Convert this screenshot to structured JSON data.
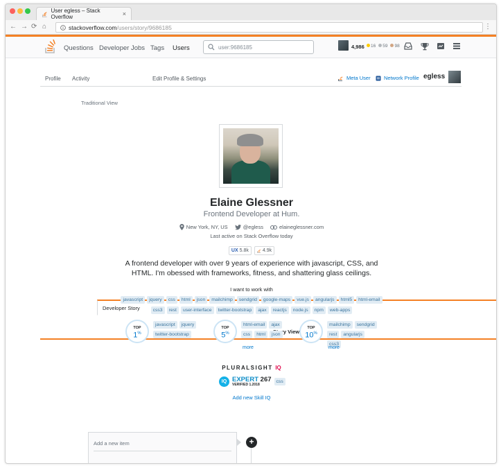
{
  "browser": {
    "tab_title": "User egless – Stack Overflow",
    "tab_close": "×",
    "url_host": "stackoverflow.com",
    "url_path": "/users/story/9686185"
  },
  "topbar": {
    "nav": [
      "Questions",
      "Developer Jobs",
      "Tags",
      "Users"
    ],
    "search_value": "user:9686185",
    "reputation": "4,986",
    "gold": "16",
    "silver": "59",
    "bronze": "98"
  },
  "profile_tabs": {
    "tabs": [
      "Profile",
      "Activity",
      "Developer Story",
      "Edit Profile & Settings"
    ],
    "meta_user": "Meta User",
    "network_profile": "Network Profile",
    "username": "egless"
  },
  "subtabs": [
    "Story View",
    "Traditional View"
  ],
  "person": {
    "name": "Elaine Glessner",
    "role": "Frontend Developer at Hum.",
    "location": "New York, NY, US",
    "twitter": "@egless",
    "website": "elaineglessner.com",
    "last_active": "Last active on Stack Overflow today",
    "site1_value": "5.8k",
    "site2_value": "4.9k",
    "bio": "A frontend developer with over 9 years of experience with javascript, CSS, and HTML. I'm obessed with frameworks, fitness, and shattering glass ceilings."
  },
  "want_label": "I want to work with",
  "want_tags_row1": [
    "javascript",
    "jquery",
    "css",
    "html",
    "json",
    "mailchimp",
    "sendgrid",
    "google-maps",
    "vue.js",
    "angularjs",
    "html5",
    "html-email"
  ],
  "want_tags_row2": [
    "css3",
    "rest",
    "user-interface",
    "twitter-bootstrap",
    "ajax",
    "reactjs",
    "node.js",
    "npm",
    "web-apps"
  ],
  "top_groups": [
    {
      "label": "TOP",
      "pct": "1",
      "unit": "%",
      "tags": [
        "javascript",
        "jquery",
        "twitter-bootstrap"
      ],
      "more": ""
    },
    {
      "label": "TOP",
      "pct": "5",
      "unit": "%",
      "tags": [
        "html-email",
        "ajax",
        "css",
        "html",
        "json"
      ],
      "more": "more"
    },
    {
      "label": "TOP",
      "pct": "10",
      "unit": "%",
      "tags": [
        "mailchimp",
        "sendgrid",
        "rest",
        "angularjs",
        "css3"
      ],
      "more": "more"
    }
  ],
  "skill_iq": {
    "brand": "PLURALSIGHT",
    "brand_iq": "IQ",
    "logo": "IQ",
    "level": "EXPERT",
    "score": "267",
    "verified": "VERIFIED 1.2018",
    "tag": "css",
    "add_link": "Add new Skill IQ"
  },
  "timeline": {
    "placeholder": "Add a new item",
    "plus": "+"
  },
  "colors": {
    "accent": "#f48024",
    "link": "#0077cc",
    "tag_bg": "#e1ecf4"
  }
}
